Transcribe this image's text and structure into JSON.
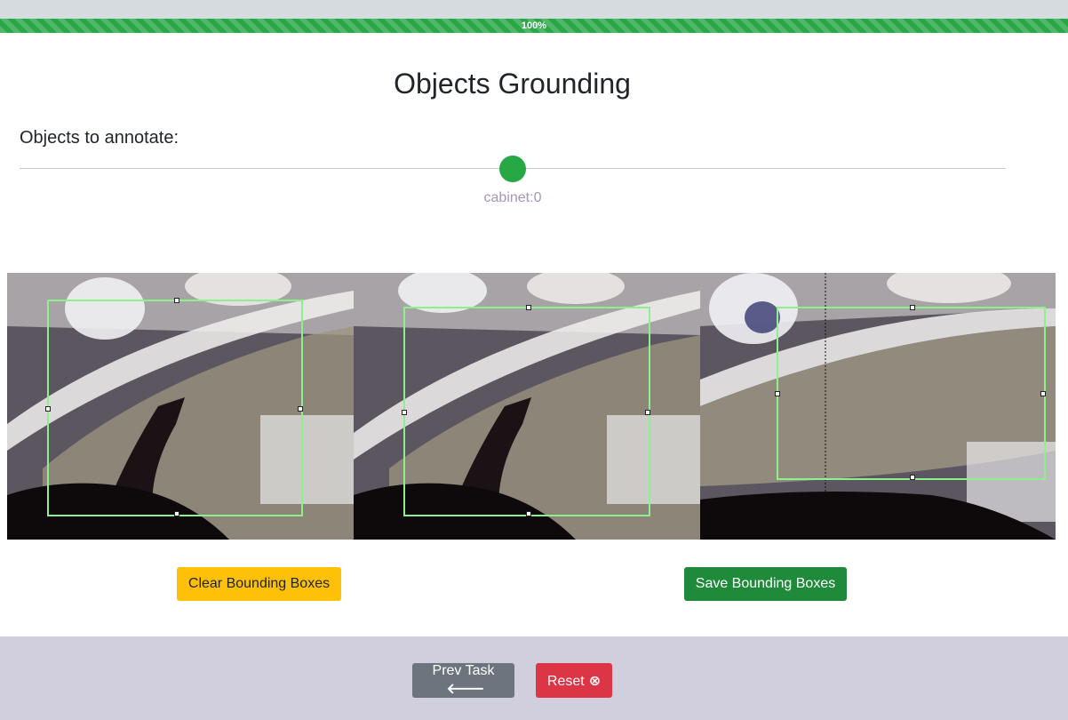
{
  "progress": {
    "label": "100%",
    "value": 1.0,
    "color": "#28a745"
  },
  "page": {
    "title": "Objects Grounding",
    "subtitle": "Objects to annotate:"
  },
  "slider": {
    "current_label": "cabinet:0",
    "thumb_color": "#28a745"
  },
  "buttons": {
    "clear_label": "Clear Bounding Boxes",
    "save_label": "Save Bounding Boxes",
    "prev_label": "Prev Task",
    "prev_icon": "arrow-left-icon",
    "reset_label": "Reset",
    "reset_icon": "close-circle-icon"
  },
  "colors": {
    "bbox": "#8cf08c",
    "footer": "#d1cfdd",
    "clear": "#ffc107",
    "save": "#1f8a3a",
    "prev": "#6c757d",
    "reset": "#dc3545"
  },
  "frames": [
    {
      "name": "frame-1"
    },
    {
      "name": "frame-2"
    },
    {
      "name": "frame-3"
    }
  ]
}
